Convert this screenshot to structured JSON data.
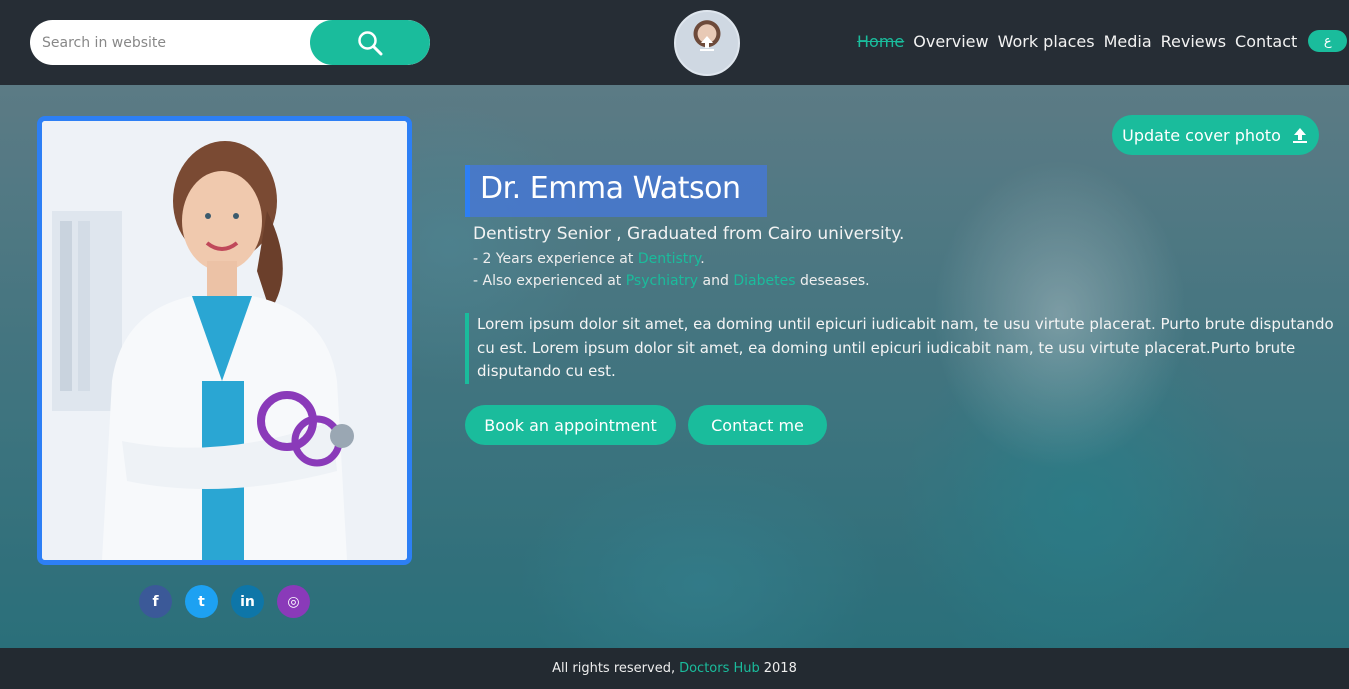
{
  "search": {
    "placeholder": "Search in website",
    "icon": "search-icon"
  },
  "nav": {
    "items": [
      "Home",
      "Overview",
      "Work places",
      "Media",
      "Reviews",
      "Contact"
    ],
    "active": "Home",
    "language_label": "ع"
  },
  "hero": {
    "update_cover_label": "Update cover photo",
    "name": "Dr. Emma Watson",
    "headline": "Dentistry Senior , Graduated from Cairo university.",
    "experience_prefix": "- 2 Years experience at ",
    "experience_field": "Dentistry",
    "experience_suffix": ".",
    "also_prefix": "- Also experienced at ",
    "also_field_1": "Psychiatry",
    "also_and": " and ",
    "also_field_2": "Diabetes",
    "also_suffix": " deseases.",
    "bio": "Lorem ipsum dolor sit amet, ea doming until epicuri iudicabit nam, te usu virtute placerat. Purto brute disputando cu est. Lorem ipsum dolor sit amet, ea doming until epicuri iudicabit nam, te usu virtute placerat.Purto brute disputando cu est.",
    "book_label": "Book an appointment",
    "contact_label": "Contact me"
  },
  "social": [
    {
      "name": "facebook-icon",
      "glyph": "f"
    },
    {
      "name": "twitter-icon",
      "glyph": "t"
    },
    {
      "name": "linkedin-icon",
      "glyph": "in"
    },
    {
      "name": "instagram-icon",
      "glyph": "◎"
    }
  ],
  "footer": {
    "prefix": "All rights reserved,",
    "brand": "Doctors Hub",
    "year": "2018"
  },
  "colors": {
    "accent": "#1abc9c",
    "card_border": "#2d7ff5",
    "bar": "#262d35"
  }
}
